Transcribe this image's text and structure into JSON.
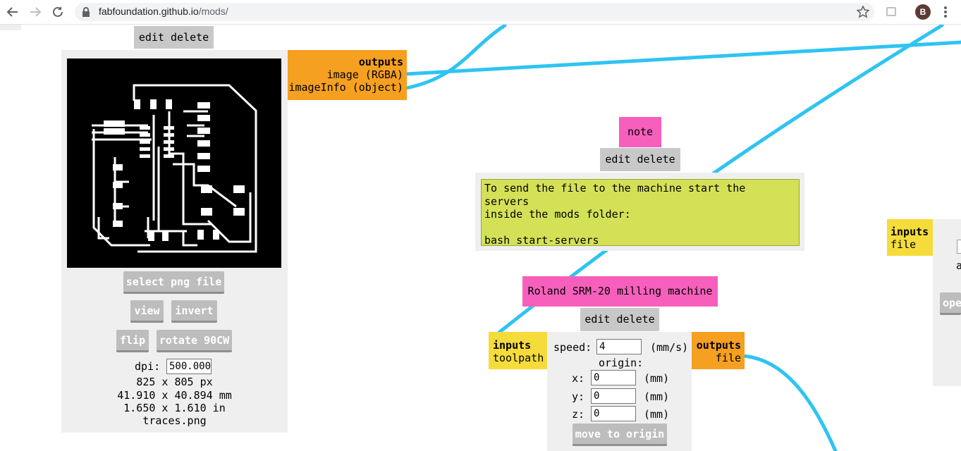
{
  "browser": {
    "url_host": "fabfoundation.github.io",
    "url_path": "/mods/",
    "profile_initial": "B"
  },
  "image_module": {
    "header_buttons": "edit delete",
    "outputs_title": "outputs",
    "outputs": [
      "image (RGBA)",
      "imageInfo (object)"
    ],
    "select_button": "select png file",
    "view_button": "view",
    "invert_button": "invert",
    "flip_button": "flip",
    "rotate_button": "rotate 90CW",
    "dpi_label": "dpi:",
    "dpi_value": "500.000",
    "size_px": "825 x 805 px",
    "size_mm": "41.910 x 40.894 mm",
    "size_in": "1.650 x 1.610 in",
    "filename": "traces.png"
  },
  "note_module": {
    "title": "note",
    "header_buttons": "edit delete",
    "text": "To send the file to the machine start the servers\ninside the mods folder:\n\nbash start-servers"
  },
  "machine_module": {
    "title": "Roland SRM-20 milling machine",
    "header_buttons": "edit delete",
    "inputs_title": "inputs",
    "inputs": [
      "toolpath"
    ],
    "outputs_title": "outputs",
    "outputs": [
      "file"
    ],
    "speed_label": "speed:",
    "speed_value": "4",
    "speed_unit": "(mm/s)",
    "origin_label": "origin:",
    "x_label": "x:",
    "x_value": "0",
    "y_label": "y:",
    "y_value": "0",
    "z_label": "z:",
    "z_value": "0",
    "unit_mm": "(mm)",
    "move_button": "move to origin"
  },
  "right_module": {
    "inputs_title": "inputs",
    "inputs": [
      "file"
    ],
    "partial_text": "a",
    "partial_button": "ope"
  },
  "colors": {
    "wire": "#2ec4f2",
    "outputs": "#f5a020",
    "inputs": "#f5dc3a",
    "title": "#f75fbd",
    "note_bg": "#d4e157"
  }
}
